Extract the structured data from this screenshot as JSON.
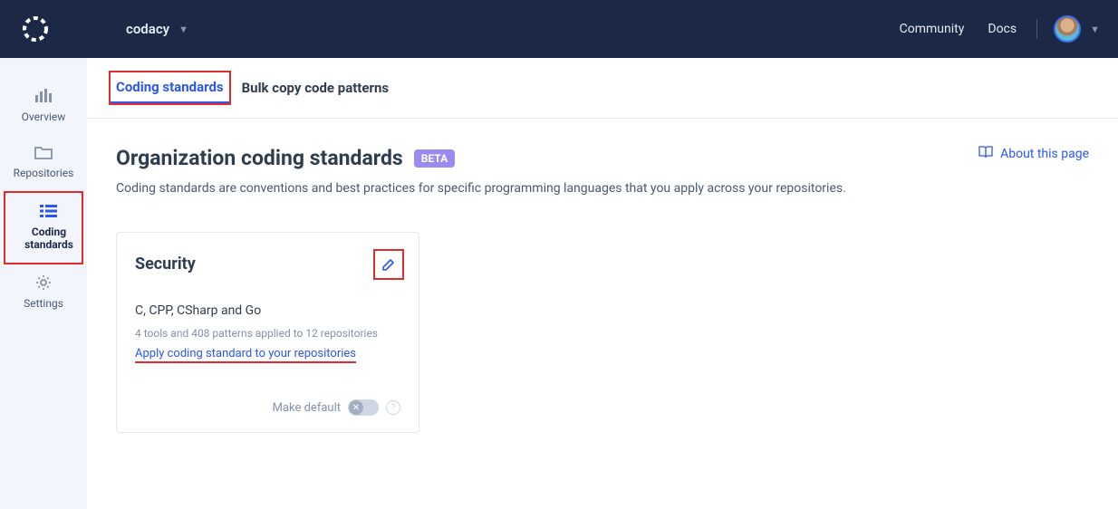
{
  "header": {
    "org_name": "codacy",
    "links": [
      "Community",
      "Docs"
    ]
  },
  "sidebar": {
    "items": [
      {
        "label": "Overview"
      },
      {
        "label": "Repositories"
      },
      {
        "label": "Coding standards"
      },
      {
        "label": "Settings"
      }
    ]
  },
  "tabs": [
    {
      "label": "Coding standards",
      "active": true
    },
    {
      "label": "Bulk copy code patterns",
      "active": false
    }
  ],
  "page": {
    "title": "Organization coding standards",
    "badge": "BETA",
    "subtitle": "Coding standards are conventions and best practices for specific programming languages that you apply across your repositories.",
    "about_link": "About this page"
  },
  "card": {
    "title": "Security",
    "languages": "C, CPP, CSharp and Go",
    "meta": "4 tools and 408 patterns applied to 12 repositories",
    "apply_link": "Apply coding standard to your repositories",
    "make_default_label": "Make default"
  }
}
